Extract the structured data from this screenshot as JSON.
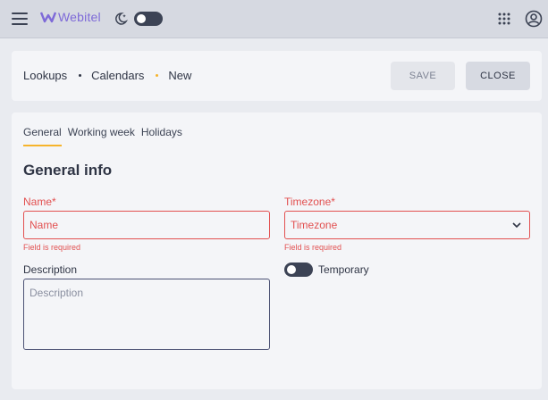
{
  "topbar": {
    "logo_text": "Webitel",
    "icons": {
      "menu": "hamburger-menu-icon",
      "theme": "moon-icon",
      "apps": "apps-grid-icon",
      "account": "account-icon"
    },
    "theme_toggle_on": false
  },
  "breadcrumb": {
    "items": [
      "Lookups",
      "Calendars",
      "New"
    ]
  },
  "actions": {
    "save_label": "SAVE",
    "close_label": "CLOSE"
  },
  "tabs": [
    {
      "label": "General",
      "active": true
    },
    {
      "label": "Working week",
      "active": false
    },
    {
      "label": "Holidays",
      "active": false
    }
  ],
  "form": {
    "section_title": "General info",
    "name": {
      "label": "Name*",
      "placeholder": "Name",
      "value": "",
      "error": "Field is required"
    },
    "timezone": {
      "label": "Timezone*",
      "placeholder": "Timezone",
      "value": "",
      "error": "Field is required"
    },
    "description": {
      "label": "Description",
      "placeholder": "Description",
      "value": ""
    },
    "temporary": {
      "label": "Temporary",
      "checked": false
    }
  },
  "colors": {
    "accent": "#f6b42c",
    "error": "#e25050",
    "brand": "#7e6ad8",
    "dark": "#3c4355"
  }
}
